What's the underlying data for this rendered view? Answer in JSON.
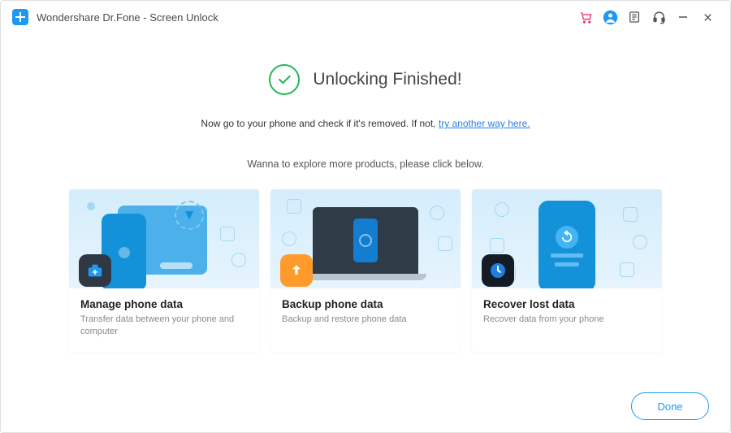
{
  "window": {
    "title": "Wondershare Dr.Fone - Screen Unlock"
  },
  "titlebar_icons": {
    "cart": "cart-icon",
    "account": "account-icon",
    "notes": "notes-icon",
    "support": "headset-icon",
    "minimize": "minimize-icon",
    "close": "close-icon"
  },
  "status": {
    "headline": "Unlocking Finished!",
    "sub_prefix": "Now go to your phone and check if it's removed. If not, ",
    "sub_link": "try another way here."
  },
  "explore_text": "Wanna to explore more products,  please click below.",
  "cards": [
    {
      "title": "Manage phone data",
      "desc": "Transfer data between your phone and computer"
    },
    {
      "title": "Backup phone data",
      "desc": "Backup and restore phone data"
    },
    {
      "title": "Recover lost data",
      "desc": "Recover data from your phone"
    }
  ],
  "footer": {
    "done": "Done"
  }
}
